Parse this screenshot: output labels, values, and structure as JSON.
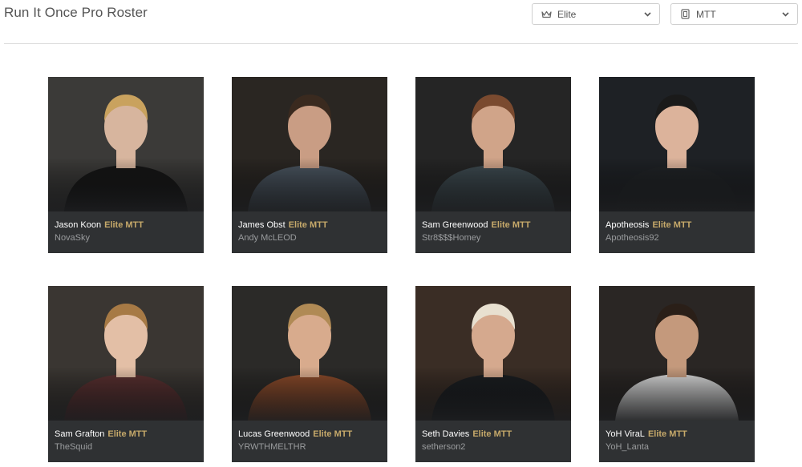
{
  "header": {
    "title": "Run It Once Pro Roster"
  },
  "filters": {
    "tier": {
      "value": "Elite",
      "icon": "crown-icon"
    },
    "format": {
      "value": "MTT",
      "icon": "card-icon"
    }
  },
  "roster": [
    {
      "name": "Jason Koon",
      "tag": "Elite MTT",
      "handle": "NovaSky",
      "bg": "#3b3a38",
      "skin": "#d7b59e",
      "hair": "#c9a25e",
      "shirt": "#151515"
    },
    {
      "name": "James Obst",
      "tag": "Elite MTT",
      "handle": "Andy McLEOD",
      "bg": "#2a2622",
      "skin": "#c99d84",
      "hair": "#3a2a1f",
      "shirt": "#4a5560"
    },
    {
      "name": "Sam Greenwood",
      "tag": "Elite MTT",
      "handle": "Str8$$$Homey",
      "bg": "#252525",
      "skin": "#d0a489",
      "hair": "#7a4a2f",
      "shirt": "#3d4a50"
    },
    {
      "name": "Apotheosis",
      "tag": "Elite MTT",
      "handle": "Apotheosis92",
      "bg": "#1e2125",
      "skin": "#dcb39b",
      "hair": "#1a1a1a",
      "shirt": "#202326"
    },
    {
      "name": "Sam Grafton",
      "tag": "Elite MTT",
      "handle": "TheSquid",
      "bg": "#3a3632",
      "skin": "#e3bfa6",
      "hair": "#a77a45",
      "shirt": "#5a3030"
    },
    {
      "name": "Lucas Greenwood",
      "tag": "Elite MTT",
      "handle": "YRWTHMELTHR",
      "bg": "#2b2a28",
      "skin": "#d8ab8d",
      "hair": "#b08a55",
      "shirt": "#8a4a2a"
    },
    {
      "name": "Seth Davies",
      "tag": "Elite MTT",
      "handle": "setherson2",
      "bg": "#3a2d25",
      "skin": "#d5a98e",
      "hair": "#e8e0d0",
      "shirt": "#1a1d20"
    },
    {
      "name": "YoH ViraL",
      "tag": "Elite MTT",
      "handle": "YoH_Lanta",
      "bg": "#2a2624",
      "skin": "#c4997c",
      "hair": "#2a1f18",
      "shirt": "#d8d8d8"
    }
  ]
}
